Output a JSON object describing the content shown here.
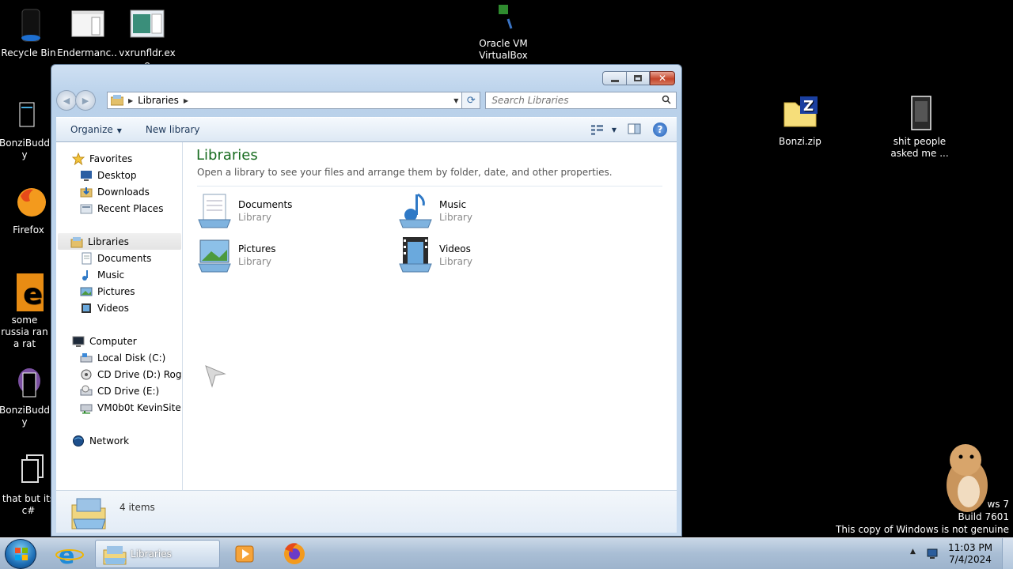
{
  "desktop": {
    "icons_left": [
      {
        "label": "Recycle Bin",
        "icon": "recycle-bin-icon"
      },
      {
        "label": "BonziBuddy",
        "icon": "bonzibuddy-shortcut-icon"
      },
      {
        "label": "Firefox",
        "icon": "firefox-icon"
      },
      {
        "label": "some russia ran a rat",
        "icon": "ie-shortcut-icon"
      },
      {
        "label": "BonziBuddy",
        "icon": "bonzibuddy-icon"
      },
      {
        "label": "that but its c#",
        "icon": "folder-shortcut-icon"
      }
    ],
    "icons_top": [
      {
        "label": "Endermanc...",
        "icon": "program-window-icon"
      },
      {
        "label": "vxrunfldr.exe",
        "icon": "exe-icon"
      },
      {
        "label": "Oracle VM VirtualBox",
        "icon": "virtualbox-icon"
      }
    ],
    "icons_right": [
      {
        "label": "Bonzi.zip",
        "icon": "zip-folder-icon"
      },
      {
        "label": "shit people asked me ...",
        "icon": "dark-folder-icon"
      }
    ],
    "watermark": {
      "line1": "ws 7",
      "line2": "Build 7601",
      "line3": "This copy of Windows is not genuine"
    }
  },
  "window": {
    "title": "Libraries",
    "address": {
      "crumb": "Libraries"
    },
    "search": {
      "placeholder": "Search Libraries"
    },
    "toolbar": {
      "organize": "Organize",
      "new_library": "New library"
    },
    "nav": {
      "favorites": "Favorites",
      "favorites_items": [
        "Desktop",
        "Downloads",
        "Recent Places"
      ],
      "libraries": "Libraries",
      "library_items": [
        "Documents",
        "Music",
        "Pictures",
        "Videos"
      ],
      "computer": "Computer",
      "computer_items": [
        "Local Disk (C:)",
        "CD Drive (D:) Rogue",
        "CD Drive (E:)",
        "VM0b0t KevinSite"
      ],
      "network": "Network"
    },
    "content": {
      "title": "Libraries",
      "subtitle": "Open a library to see your files and arrange them by folder, date, and other properties.",
      "libraries": [
        {
          "name": "Documents",
          "type": "Library",
          "icon": "documents-library-icon"
        },
        {
          "name": "Music",
          "type": "Library",
          "icon": "music-library-icon"
        },
        {
          "name": "Pictures",
          "type": "Library",
          "icon": "pictures-library-icon"
        },
        {
          "name": "Videos",
          "type": "Library",
          "icon": "videos-library-icon"
        }
      ]
    },
    "details": {
      "count": "4 items"
    }
  },
  "taskbar": {
    "active_window": "Libraries",
    "clock": {
      "time": "11:03 PM",
      "date": "7/4/2024"
    }
  }
}
